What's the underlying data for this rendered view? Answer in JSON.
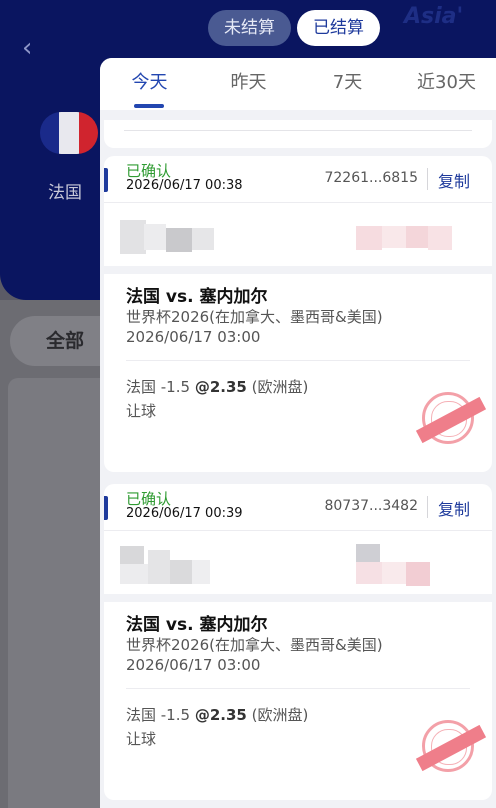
{
  "background": {
    "team_name": "法国",
    "filter_label": "全部",
    "watermark": "Asia'"
  },
  "top_segment": {
    "unsettled": "未结算",
    "settled": "已结算",
    "active": "settled"
  },
  "date_tabs": [
    {
      "label": "今天",
      "active": true
    },
    {
      "label": "昨天",
      "active": false
    },
    {
      "label": "7天",
      "active": false
    },
    {
      "label": "近30天",
      "active": false
    }
  ],
  "bets": [
    {
      "status": "已确认",
      "placed_time": "2026/06/17 00:38",
      "order_no": "72261...6815",
      "copy_label": "复制",
      "match": "法国 vs. 塞内加尔",
      "league": "世界杯2026(在加拿大、墨西哥&美国)",
      "match_time": "2026/06/17 03:00",
      "pick": "法国 -1.5",
      "odds": "@2.35",
      "odds_type": "(欧洲盘)",
      "market": "让球"
    },
    {
      "status": "已确认",
      "placed_time": "2026/06/17 00:39",
      "order_no": "80737...3482",
      "copy_label": "复制",
      "match": "法国 vs. 塞内加尔",
      "league": "世界杯2026(在加拿大、墨西哥&美国)",
      "match_time": "2026/06/17 03:00",
      "pick": "法国 -1.5",
      "odds": "@2.35",
      "odds_type": "(欧洲盘)",
      "market": "让球"
    }
  ],
  "colors": {
    "primary": "#1e3a9c",
    "confirmed": "#2f9b32",
    "stamp": "#ef7e8a"
  }
}
